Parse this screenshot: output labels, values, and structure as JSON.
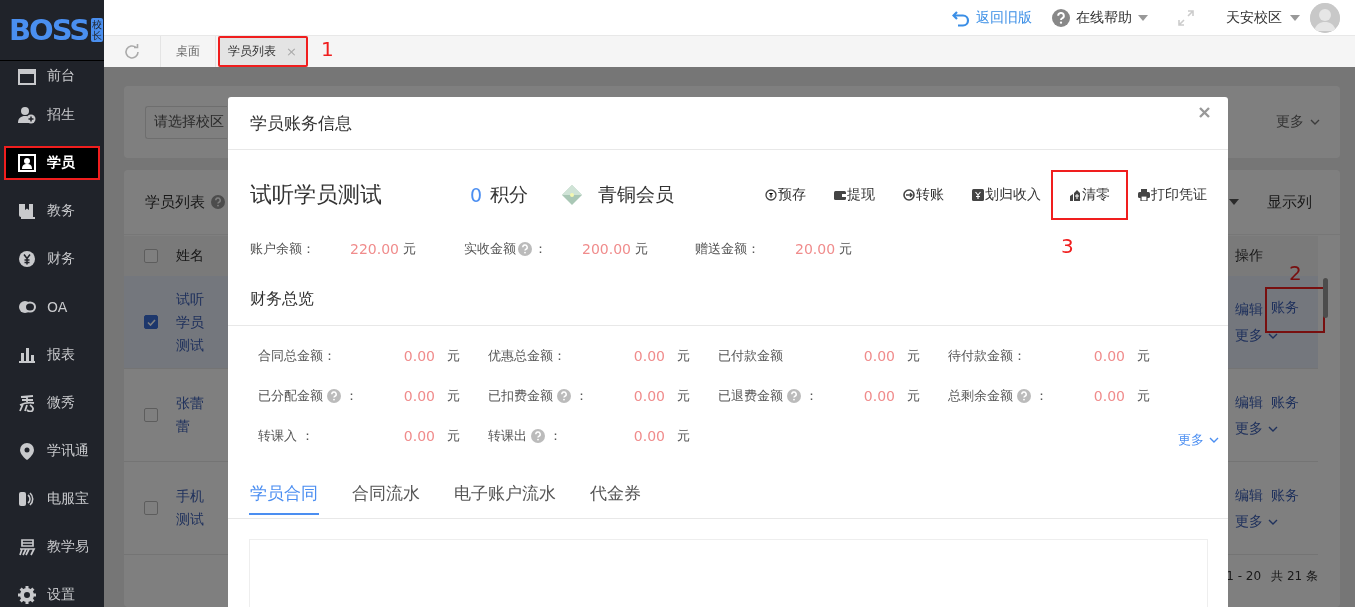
{
  "logo": {
    "text": "BOSS",
    "badge": "校长"
  },
  "sidebar": {
    "items": [
      {
        "label": "前台",
        "selected": false,
        "marked": false
      },
      {
        "label": "招生",
        "selected": false,
        "marked": false
      },
      {
        "label": "学员",
        "selected": true,
        "marked": true
      },
      {
        "label": "教务",
        "selected": false,
        "marked": false
      },
      {
        "label": "财务",
        "selected": false,
        "marked": false
      },
      {
        "label": "OA",
        "selected": false,
        "marked": false
      },
      {
        "label": "报表",
        "selected": false,
        "marked": false
      },
      {
        "label": "微秀",
        "selected": false,
        "marked": false
      },
      {
        "label": "学讯通",
        "selected": false,
        "marked": false
      },
      {
        "label": "电服宝",
        "selected": false,
        "marked": false
      },
      {
        "label": "教学易",
        "selected": false,
        "marked": false
      },
      {
        "label": "设置",
        "selected": false,
        "marked": false
      }
    ]
  },
  "topbar": {
    "back_link": "返回旧版",
    "help": "在线帮助",
    "campus": "天安校区"
  },
  "page_tabs": [
    {
      "label": "桌面",
      "selected": false,
      "closable": false,
      "marked": false
    },
    {
      "label": "学员列表",
      "selected": true,
      "closable": true,
      "close": "×",
      "marked": true,
      "note": "1"
    }
  ],
  "filter": {
    "campus_select": {
      "placeholder": "请选择校区"
    },
    "more": "更多"
  },
  "student_list": {
    "title": "学员列表",
    "show_columns": "显示列",
    "all_checked": false,
    "columns": [
      "姓名",
      "操作"
    ],
    "rows": [
      {
        "name": "试听学员测试",
        "selected": true,
        "actions": [
          {
            "label": "编辑",
            "marked": false
          },
          {
            "label": "账务",
            "marked": true,
            "note": "2"
          }
        ],
        "more": "更多"
      },
      {
        "name": "张蕾蕾",
        "selected": false,
        "actions": [
          {
            "label": "编辑",
            "marked": false
          },
          {
            "label": "账务",
            "marked": false
          }
        ],
        "more": "更多"
      },
      {
        "name": "手机测试",
        "selected": false,
        "actions": [
          {
            "label": "编辑",
            "marked": false
          },
          {
            "label": "账务",
            "marked": false
          }
        ],
        "more": "更多"
      }
    ],
    "pagination": {
      "range": "1 - 20",
      "total": "共 21 条"
    }
  },
  "modal": {
    "title": "学员账务信息",
    "student": {
      "name": "试听学员测试",
      "points": "0",
      "points_label": "积分",
      "tier": "青铜会员"
    },
    "actions": [
      {
        "label": "预存",
        "marked": false
      },
      {
        "label": "提现",
        "marked": false
      },
      {
        "label": "转账",
        "marked": false
      },
      {
        "label": "划归收入",
        "marked": false
      },
      {
        "label": "清零",
        "marked": true,
        "note": "3"
      },
      {
        "label": "打印凭证",
        "marked": false
      }
    ],
    "balances": [
      {
        "label": "账户余额：",
        "help": false,
        "value": "220.00",
        "unit": "元"
      },
      {
        "label": "实收金额",
        "help": true,
        "colon": "：",
        "value": "200.00",
        "unit": "元"
      },
      {
        "label": "赠送金额：",
        "help": false,
        "value": "20.00",
        "unit": "元"
      }
    ],
    "overview": {
      "title": "财务总览",
      "more": "更多",
      "stats": [
        {
          "label": "合同总金额：",
          "help": false,
          "value": "0.00",
          "unit": "元"
        },
        {
          "label": "优惠总金额：",
          "help": false,
          "value": "0.00",
          "unit": "元"
        },
        {
          "label": "已付款金额",
          "help": false,
          "value": "0.00",
          "unit": "元"
        },
        {
          "label": "待付款金额：",
          "help": false,
          "value": "0.00",
          "unit": "元"
        },
        {
          "label": "已分配金额",
          "help": true,
          "colon": "：",
          "value": "0.00",
          "unit": "元"
        },
        {
          "label": "已扣费金额",
          "help": true,
          "colon": "：",
          "value": "0.00",
          "unit": "元"
        },
        {
          "label": "已退费金额",
          "help": true,
          "colon": "：",
          "value": "0.00",
          "unit": "元"
        },
        {
          "label": "总剩余金额",
          "help": true,
          "colon": "：",
          "value": "0.00",
          "unit": "元"
        },
        {
          "label": "转课入 ：",
          "help": false,
          "value": "0.00",
          "unit": "元"
        },
        {
          "label": "转课出",
          "help": true,
          "colon": "：",
          "value": "0.00",
          "unit": "元"
        }
      ]
    },
    "tabs": [
      {
        "label": "学员合同",
        "selected": true
      },
      {
        "label": "合同流水",
        "selected": false
      },
      {
        "label": "电子账户流水",
        "selected": false
      },
      {
        "label": "代金券",
        "selected": false
      }
    ]
  }
}
